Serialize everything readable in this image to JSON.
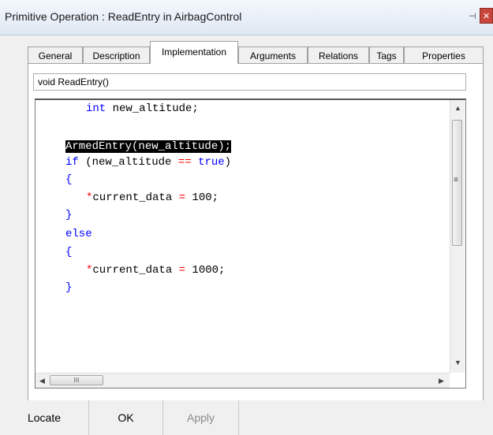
{
  "window": {
    "title": "Primitive Operation : ReadEntry in AirbagControl",
    "pin_glyph": "⊣",
    "close_glyph": "✕"
  },
  "tabs": [
    {
      "label": "General"
    },
    {
      "label": "Description"
    },
    {
      "label": "Implementation",
      "active": true
    },
    {
      "label": "Arguments"
    },
    {
      "label": "Relations"
    },
    {
      "label": "Tags"
    },
    {
      "label": "Properties"
    }
  ],
  "signature": "void ReadEntry()",
  "code": {
    "line1_type": "int",
    "line1_rest": " new_altitude;",
    "line2_call": "ArmedEntry(new_altitude);",
    "line3_kw": "if",
    "line3_a": " (new_altitude ",
    "line3_op": "==",
    "line3_b": " ",
    "line3_true": "true",
    "line3_c": ")",
    "open_brace": "{",
    "close_brace": "}",
    "star": "*",
    "assign_a_name": "current_data ",
    "assign_op": "=",
    "assign_a_val": " 100;",
    "else_kw": "else",
    "assign_b_val": " 1000;"
  },
  "scrollbar": {
    "up": "▲",
    "down": "▼",
    "left": "◀",
    "right": "▶",
    "grip_v": "≡",
    "grip_h": "III"
  },
  "footer": {
    "locate": "Locate",
    "ok": "OK",
    "apply": "Apply"
  }
}
